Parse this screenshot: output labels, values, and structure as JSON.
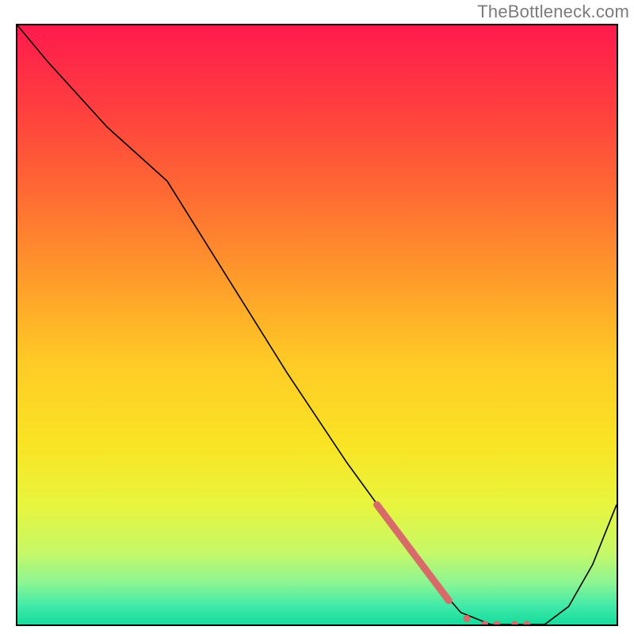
{
  "watermark": "TheBottleneck.com",
  "chart_data": {
    "type": "line",
    "title": "",
    "xlabel": "",
    "ylabel": "",
    "xlim": [
      0,
      100
    ],
    "ylim": [
      0,
      100
    ],
    "grid": false,
    "legend": false,
    "background": {
      "type": "vertical_gradient",
      "stops": [
        {
          "pos": 0.0,
          "color": "#ff1a4d"
        },
        {
          "pos": 0.14,
          "color": "#ff3f3f"
        },
        {
          "pos": 0.28,
          "color": "#ff6a33"
        },
        {
          "pos": 0.42,
          "color": "#ff9a2b"
        },
        {
          "pos": 0.56,
          "color": "#ffca26"
        },
        {
          "pos": 0.7,
          "color": "#f9e424"
        },
        {
          "pos": 0.8,
          "color": "#e8f53e"
        },
        {
          "pos": 0.88,
          "color": "#c6f867"
        },
        {
          "pos": 0.93,
          "color": "#8df592"
        },
        {
          "pos": 0.97,
          "color": "#3fe9a9"
        },
        {
          "pos": 1.0,
          "color": "#15dc9d"
        }
      ]
    },
    "series": [
      {
        "name": "bottleneck-curve",
        "color": "#000000",
        "x": [
          0,
          5,
          15,
          25,
          35,
          45,
          55,
          63,
          68,
          74,
          79,
          84,
          88,
          92,
          96,
          100
        ],
        "y": [
          100,
          94,
          83,
          74,
          58,
          42,
          27,
          16,
          9,
          2,
          0,
          0,
          0,
          3,
          10,
          20
        ]
      }
    ],
    "annotations": [
      {
        "name": "highlight-segment",
        "type": "dotted-overlay",
        "color": "#d86a6a",
        "x": [
          60,
          63,
          66,
          69,
          72,
          75,
          78,
          80,
          83,
          85
        ],
        "y": [
          20,
          16,
          12,
          8,
          4,
          1,
          0,
          0,
          0,
          0
        ]
      }
    ]
  }
}
